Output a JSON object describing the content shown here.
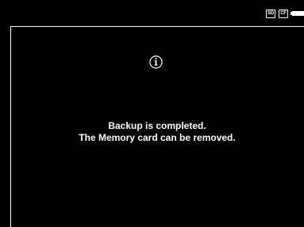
{
  "status_bar": {
    "sd_card_label": "SD",
    "cf_card_label": "CF",
    "battery_icon": "battery-full-icon"
  },
  "dialog": {
    "icon": "info-icon",
    "message_line1": "Backup is completed.",
    "message_line2": "The Memory card can be removed."
  },
  "colors": {
    "background": "#000000",
    "foreground": "#ffffff"
  }
}
